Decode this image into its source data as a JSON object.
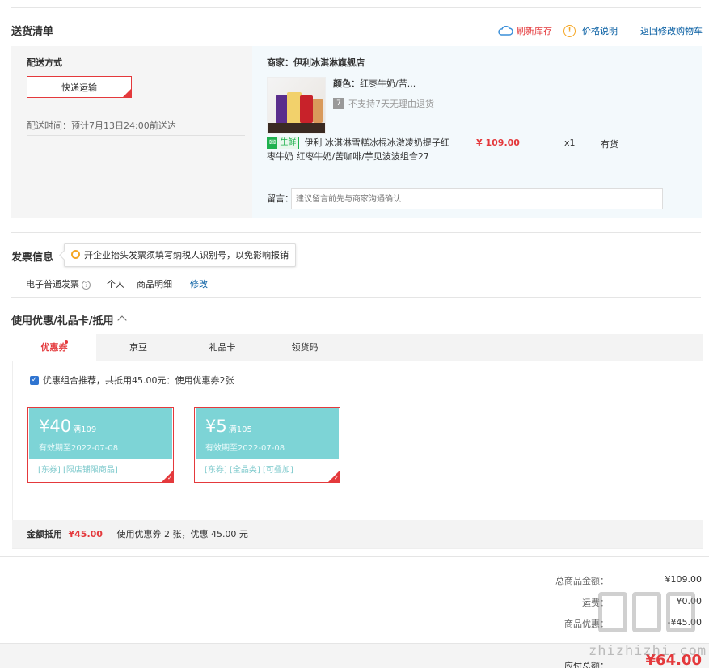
{
  "delivery": {
    "title": "送货清单",
    "links": {
      "refresh": "刷新库存",
      "price_note": "价格说明",
      "back_cart": "返回修改购物车"
    },
    "method_label": "配送方式",
    "method_value": "快递运输",
    "time_text": "配送时间：预计7月13日24:00前送达",
    "merchant": "商家：伊利冰淇淋旗舰店",
    "color_label": "颜色：",
    "color_value": "红枣牛奶/苦...",
    "no_return_icon": "7",
    "no_return": "不支持7天无理由退货",
    "fresh_tag": "生鲜",
    "product_name": "伊利 冰淇淋雪糕冰棍冰激凌奶提子红枣牛奶 红枣牛奶/苦咖啡/芋见波波组合27",
    "price": "¥ 109.00",
    "qty": "x1",
    "stock": "有货",
    "message_label": "留言：",
    "message_placeholder": "建议留言前先与商家沟通确认"
  },
  "invoice": {
    "title": "发票信息",
    "tip": "开企业抬头发票须填写纳税人识别号，以免影响报销",
    "type": "电子普通发票",
    "personal": "个人",
    "detail": "商品明细",
    "edit": "修改"
  },
  "coupons": {
    "title": "使用优惠/礼品卡/抵用",
    "tabs": [
      "优惠券",
      "京豆",
      "礼品卡",
      "领货码"
    ],
    "combo_text": "优惠组合推荐，共抵用45.00元：使用优惠券2张",
    "items": [
      {
        "amount": "¥40",
        "condition": "满109",
        "validity": "有效期至2022-07-08",
        "tags": "[东券] [限店铺限商品]"
      },
      {
        "amount": "¥5",
        "condition": "满105",
        "validity": "有效期至2022-07-08",
        "tags": "[东券] [全品类] [可叠加]"
      }
    ],
    "summary_label": "金额抵用",
    "summary_amount": "¥45.00",
    "summary_text": "使用优惠券 2 张，优惠 45.00 元"
  },
  "totals": {
    "goods_label": "总商品金额：",
    "goods_value": "¥109.00",
    "freight_label": "运费：",
    "freight_value": "¥0.00",
    "discount_label": "商品优惠：",
    "discount_value": "-¥45.00",
    "pay_label": "应付总额：",
    "pay_value": "¥64.00"
  },
  "watermark": "zhizhizhi.com",
  "colors": {
    "accent": "#e4393c",
    "link": "#005aa0",
    "coupon": "#7dd4d6",
    "fresh": "#1fb14e"
  }
}
